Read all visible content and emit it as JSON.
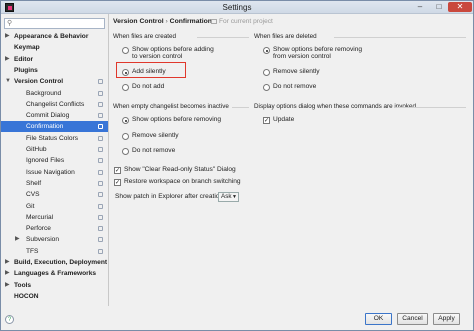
{
  "window": {
    "title": "Settings"
  },
  "search": {
    "placeholder": ""
  },
  "sidebar": {
    "items": [
      {
        "label": "Appearance & Behavior",
        "bold": true,
        "arrow": "▶",
        "indent": 0
      },
      {
        "label": "Keymap",
        "bold": true,
        "arrow": "",
        "indent": 0
      },
      {
        "label": "Editor",
        "bold": true,
        "arrow": "▶",
        "indent": 0
      },
      {
        "label": "Plugins",
        "bold": true,
        "arrow": "",
        "indent": 0
      },
      {
        "label": "Version Control",
        "bold": true,
        "arrow": "▼",
        "indent": 0
      },
      {
        "label": "Background",
        "bold": false,
        "arrow": "",
        "indent": 1
      },
      {
        "label": "Changelist Conflicts",
        "bold": false,
        "arrow": "",
        "indent": 1
      },
      {
        "label": "Commit Dialog",
        "bold": false,
        "arrow": "",
        "indent": 1
      },
      {
        "label": "Confirmation",
        "bold": false,
        "arrow": "",
        "indent": 1,
        "selected": true
      },
      {
        "label": "File Status Colors",
        "bold": false,
        "arrow": "",
        "indent": 1
      },
      {
        "label": "GitHub",
        "bold": false,
        "arrow": "",
        "indent": 1
      },
      {
        "label": "Ignored Files",
        "bold": false,
        "arrow": "",
        "indent": 1
      },
      {
        "label": "Issue Navigation",
        "bold": false,
        "arrow": "",
        "indent": 1
      },
      {
        "label": "Shelf",
        "bold": false,
        "arrow": "",
        "indent": 1
      },
      {
        "label": "CVS",
        "bold": false,
        "arrow": "",
        "indent": 1
      },
      {
        "label": "Git",
        "bold": false,
        "arrow": "",
        "indent": 1
      },
      {
        "label": "Mercurial",
        "bold": false,
        "arrow": "",
        "indent": 1
      },
      {
        "label": "Perforce",
        "bold": false,
        "arrow": "",
        "indent": 1
      },
      {
        "label": "Subversion",
        "bold": false,
        "arrow": "▶",
        "indent": 1
      },
      {
        "label": "TFS",
        "bold": false,
        "arrow": "",
        "indent": 1
      },
      {
        "label": "Build, Execution, Deployment",
        "bold": true,
        "arrow": "▶",
        "indent": 0
      },
      {
        "label": "Languages & Frameworks",
        "bold": true,
        "arrow": "▶",
        "indent": 0
      },
      {
        "label": "Tools",
        "bold": true,
        "arrow": "▶",
        "indent": 0
      },
      {
        "label": "HOCON",
        "bold": true,
        "arrow": "",
        "indent": 0
      }
    ]
  },
  "breadcrumb": {
    "parent": "Version Control",
    "separator": "›",
    "current": "Confirmation"
  },
  "scope": {
    "label": "For current project"
  },
  "files_created": {
    "title": "When files are created",
    "options": [
      {
        "label": "Show options before adding",
        "label2": "to version control",
        "checked": false
      },
      {
        "label": "Add silently",
        "checked": true
      },
      {
        "label": "Do not add",
        "checked": false
      }
    ]
  },
  "files_deleted": {
    "title": "When files are deleted",
    "options": [
      {
        "label": "Show options before removing",
        "label2": "from version control",
        "checked": true
      },
      {
        "label": "Remove silently",
        "checked": false
      },
      {
        "label": "Do not remove",
        "checked": false
      }
    ]
  },
  "empty_changelist": {
    "title": "When empty changelist becomes inactive",
    "options": [
      {
        "label": "Show options before removing",
        "checked": true
      },
      {
        "label": "Remove silently",
        "checked": false
      },
      {
        "label": "Do not remove",
        "checked": false
      }
    ]
  },
  "display_options": {
    "title": "Display options dialog when these commands are invoked",
    "update_label": "Update",
    "update_checked": true
  },
  "extras": {
    "clear_readonly_label": "Show \"Clear Read-only Status\" Dialog",
    "clear_readonly_checked": true,
    "restore_workspace_label": "Restore workspace on branch switching",
    "restore_workspace_checked": true,
    "show_patch_label": "Show patch in Explorer after creation:",
    "show_patch_value": "Ask"
  },
  "footer": {
    "help": "?",
    "ok": "OK",
    "cancel": "Cancel",
    "apply": "Apply"
  }
}
